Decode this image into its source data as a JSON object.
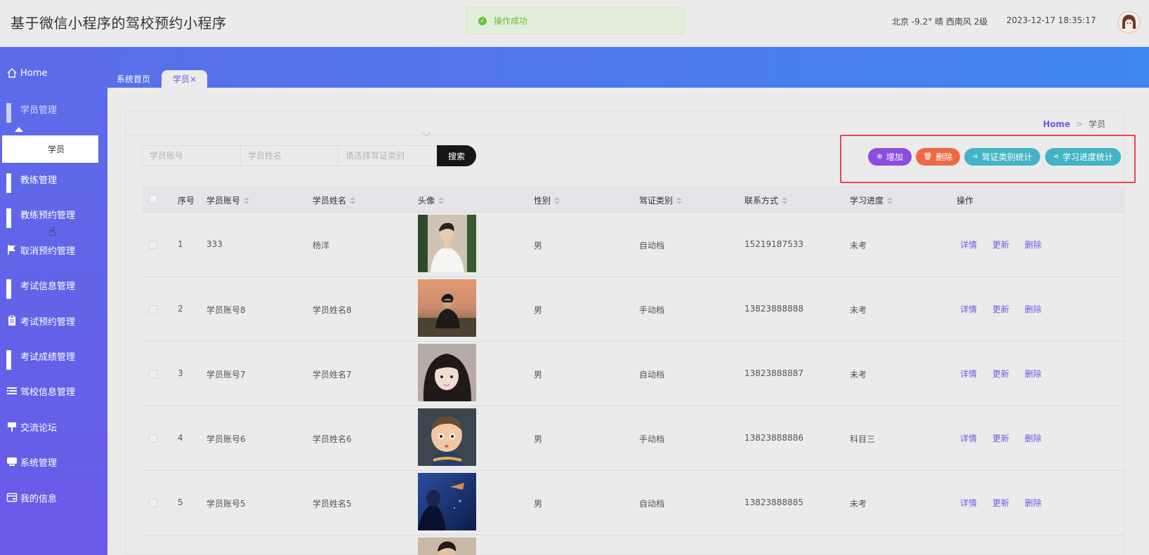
{
  "header": {
    "app_title": "基于微信小程序的驾校预约小程序",
    "toast": "操作成功",
    "weather": "北京  -9.2°  晴  西南风  2级",
    "datetime": "2023-12-17 18:35:17"
  },
  "sidebar": {
    "home": "Home",
    "items": [
      {
        "label": "学员管理",
        "icon": "grid-icon"
      },
      {
        "label": "教练管理",
        "icon": "grid-icon"
      },
      {
        "label": "教练预约管理",
        "icon": "grid-icon"
      },
      {
        "label": "取消预约管理",
        "icon": "flag-icon"
      },
      {
        "label": "考试信息管理",
        "icon": "grid-icon"
      },
      {
        "label": "考试预约管理",
        "icon": "clipboard-icon"
      },
      {
        "label": "考试成绩管理",
        "icon": "grid-icon"
      },
      {
        "label": "驾校信息管理",
        "icon": "list-icon"
      },
      {
        "label": "交流论坛",
        "icon": "sign-icon"
      },
      {
        "label": "系统管理",
        "icon": "monitor-icon"
      },
      {
        "label": "我的信息",
        "icon": "card-icon"
      }
    ],
    "submenu_item": "学员"
  },
  "tabs": {
    "home": "系统首页",
    "active": "学员×"
  },
  "breadcrumb": {
    "home": "Home",
    "sep": ">",
    "current": "学员"
  },
  "search": {
    "account_placeholder": "学员账号",
    "name_placeholder": "学员姓名",
    "type_placeholder": "请选择驾证类别",
    "button": "搜索"
  },
  "actions": {
    "add": "增加",
    "delete": "删除",
    "license_stats": "驾证类别统计",
    "progress_stats": "学习进度统计",
    "colors": {
      "add": "#8a4fe0",
      "delete": "#ec6b45",
      "stats": "#42b4c5"
    }
  },
  "table": {
    "headers": [
      "序号",
      "学员账号",
      "学员姓名",
      "头像",
      "性别",
      "驾证类别",
      "联系方式",
      "学习进度",
      "操作"
    ],
    "rows": [
      {
        "no": "1",
        "account": "333",
        "name": "杨洋",
        "gender": "男",
        "license": "自动档",
        "phone": "15219187533",
        "progress": "未考"
      },
      {
        "no": "2",
        "account": "学员账号8",
        "name": "学员姓名8",
        "gender": "男",
        "license": "手动档",
        "phone": "13823888888",
        "progress": "未考"
      },
      {
        "no": "3",
        "account": "学员账号7",
        "name": "学员姓名7",
        "gender": "男",
        "license": "自动档",
        "phone": "13823888887",
        "progress": "未考"
      },
      {
        "no": "4",
        "account": "学员账号6",
        "name": "学员姓名6",
        "gender": "男",
        "license": "手动档",
        "phone": "13823888886",
        "progress": "科目三"
      },
      {
        "no": "5",
        "account": "学员账号5",
        "name": "学员姓名5",
        "gender": "男",
        "license": "自动档",
        "phone": "13823888885",
        "progress": "未考"
      }
    ],
    "row_actions": {
      "detail": "详情",
      "update": "更新",
      "delete": "删除"
    }
  }
}
